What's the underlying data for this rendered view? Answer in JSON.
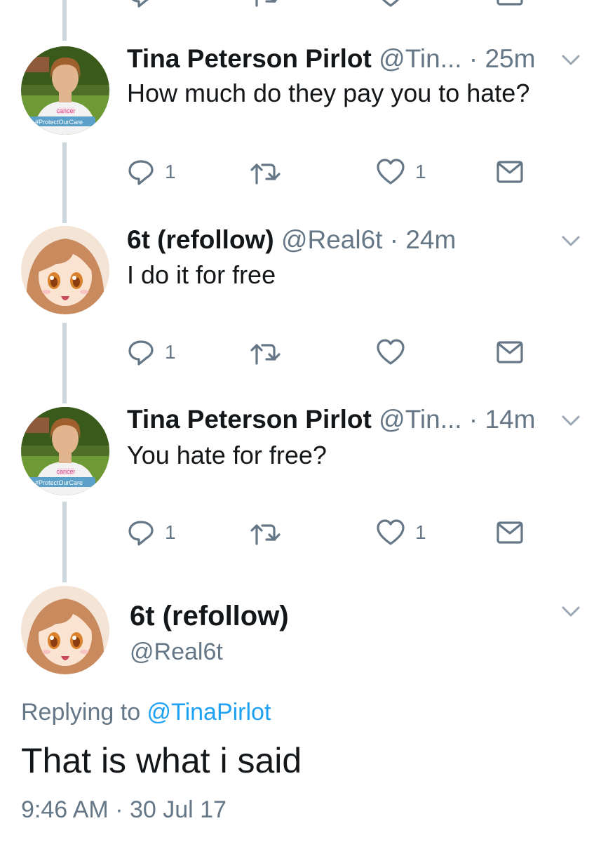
{
  "tweets": [
    {
      "name": "Tina Peterson Pirlot",
      "handle": "@Tin...",
      "sep": " · ",
      "time": "25m",
      "text": "How much do they pay you to hate?",
      "avatar": "woman-photo-avatar",
      "avatar_badge_top": "cancer",
      "avatar_badge_bottom": "#ProtectOurCare",
      "reply_count": "1",
      "retweet_count": "",
      "like_count": "1"
    },
    {
      "name": "6t (refollow)",
      "handle": "@Real6t",
      "sep": " · ",
      "time": "24m",
      "text": "I do it for free",
      "avatar": "anime-girl-avatar",
      "reply_count": "1",
      "retweet_count": "",
      "like_count": ""
    },
    {
      "name": "Tina Peterson Pirlot",
      "handle": "@Tin...",
      "sep": " · ",
      "time": "14m",
      "text": "You hate for free?",
      "avatar": "woman-photo-avatar",
      "avatar_badge_top": "cancer",
      "avatar_badge_bottom": "#ProtectOurCare",
      "reply_count": "1",
      "retweet_count": "",
      "like_count": "1"
    }
  ],
  "main_tweet": {
    "name": "6t (refollow)",
    "handle": "@Real6t",
    "replying_prefix": "Replying to ",
    "replying_to": "@TinaPirlot",
    "text": "That is what i said",
    "timestamp": "9:46 AM · 30 Jul 17",
    "avatar": "anime-girl-avatar"
  },
  "colors": {
    "text": "#14171a",
    "secondary": "#657786",
    "link": "#1da1f2",
    "thread_line": "#ccd6dd"
  },
  "icons": [
    "reply-icon",
    "retweet-icon",
    "like-icon",
    "dm-icon",
    "chevron-down-icon"
  ]
}
